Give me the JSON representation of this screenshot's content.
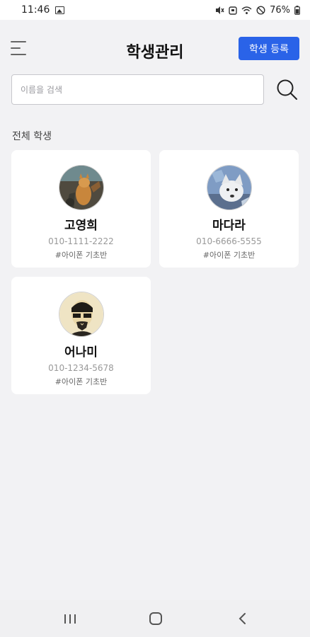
{
  "status_bar": {
    "time": "11:46",
    "battery": "76%",
    "icons": [
      "image-icon",
      "mute-icon",
      "alarm-icon",
      "wifi-icon",
      "do-not-disturb-icon",
      "battery-icon"
    ]
  },
  "header": {
    "title": "학생관리",
    "register_label": "학생 등록",
    "accent_color": "#2a63e8"
  },
  "search": {
    "placeholder": "이름을 검색",
    "value": ""
  },
  "section": {
    "title": "전체 학생"
  },
  "students": [
    {
      "name": "고영희",
      "phone": "010-1111-2222",
      "class": "#아이폰 기초반",
      "avatar": "cat-photo"
    },
    {
      "name": "마다라",
      "phone": "010-6666-5555",
      "class": "#아이폰 기초반",
      "avatar": "white-dog-photo"
    },
    {
      "name": "어나미",
      "phone": "010-1234-5678",
      "class": "#아이폰 기초반",
      "avatar": "masked-man-photo"
    }
  ],
  "nav": {
    "items": [
      "recent-apps-icon",
      "home-icon",
      "back-icon"
    ]
  }
}
